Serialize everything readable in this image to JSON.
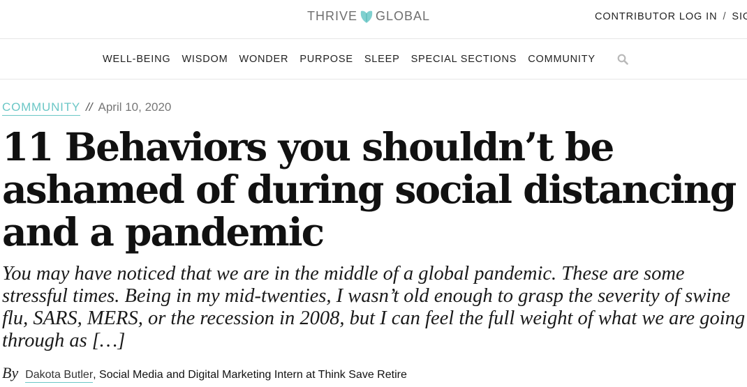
{
  "header": {
    "logo_left": "THRIVE",
    "logo_right": "GLOBAL",
    "login": "CONTRIBUTOR LOG IN",
    "separator": "/",
    "signup": "SIG"
  },
  "nav": {
    "items": [
      "WELL-BEING",
      "WISDOM",
      "WONDER",
      "PURPOSE",
      "SLEEP",
      "SPECIAL SECTIONS",
      "COMMUNITY"
    ],
    "search_icon": "search-icon"
  },
  "article": {
    "category": "COMMUNITY",
    "separator": "//",
    "date": "April 10, 2020",
    "title": "11 Behaviors you shouldn’t be ashamed of during social distancing and a pandemic",
    "excerpt": "You may have noticed that we are in the middle of a global pandemic. These are some stressful times. Being in my mid-twenties, I wasn’t old enough to grasp the severity of swine flu, SARS, MERS, or the recession in 2008, but I can feel the full weight of what we are going through as […]",
    "by": "By",
    "author": "Dakota Butler",
    "author_role": ", Social Media and Digital Marketing Intern at Think Save Retire"
  },
  "colors": {
    "accent": "#6bc7c6",
    "logo_text": "#6f6f6f",
    "border": "#e6e6e6"
  }
}
